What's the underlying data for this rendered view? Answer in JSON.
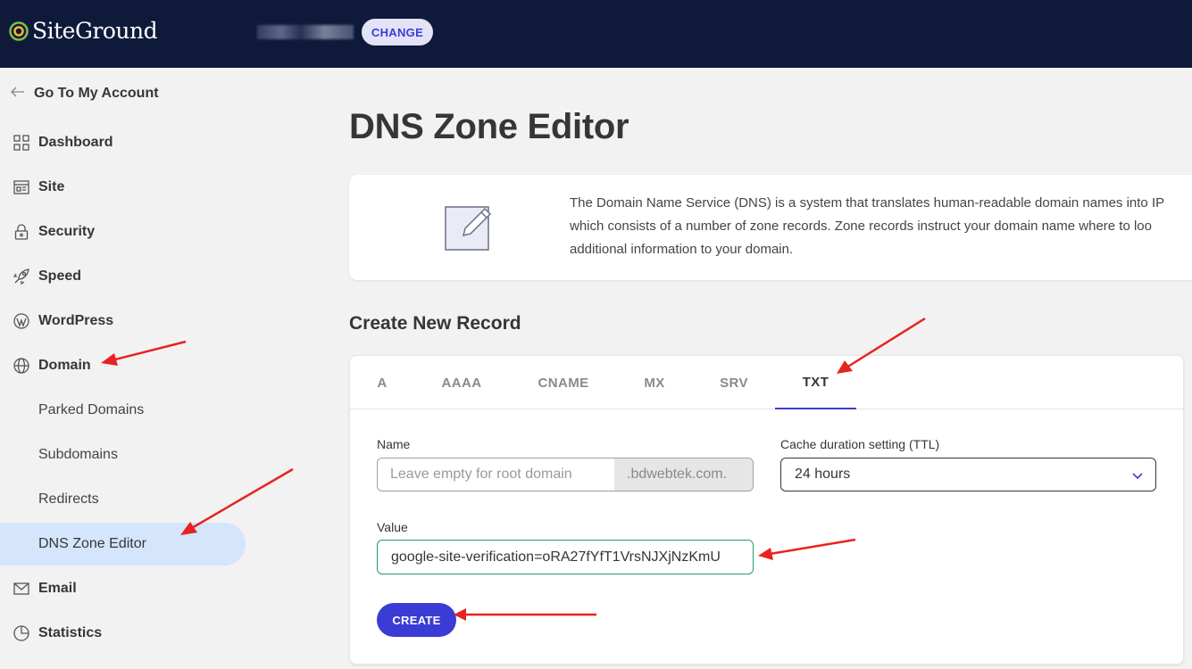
{
  "header": {
    "logo_text": "SiteGround",
    "change_label": "CHANGE"
  },
  "sidebar": {
    "back_label": "Go To My Account",
    "items": [
      {
        "label": "Dashboard",
        "icon": "dashboard-icon"
      },
      {
        "label": "Site",
        "icon": "site-icon"
      },
      {
        "label": "Security",
        "icon": "lock-icon"
      },
      {
        "label": "Speed",
        "icon": "rocket-icon"
      },
      {
        "label": "WordPress",
        "icon": "wordpress-icon"
      },
      {
        "label": "Domain",
        "icon": "globe-icon"
      }
    ],
    "domain_subitems": [
      {
        "label": "Parked Domains"
      },
      {
        "label": "Subdomains"
      },
      {
        "label": "Redirects"
      },
      {
        "label": "DNS Zone Editor",
        "active": true
      }
    ],
    "bottom_items": [
      {
        "label": "Email",
        "icon": "mail-icon"
      },
      {
        "label": "Statistics",
        "icon": "pie-chart-icon"
      }
    ]
  },
  "main": {
    "title": "DNS Zone Editor",
    "info_lines": [
      "The Domain Name Service (DNS) is a system that translates human-readable domain names into IP",
      "which consists of a number of zone records. Zone records instruct your domain name where to loo",
      "additional information to your domain."
    ],
    "section_title": "Create New Record",
    "tabs": [
      "A",
      "AAAA",
      "CNAME",
      "MX",
      "SRV",
      "TXT"
    ],
    "active_tab": "TXT",
    "form": {
      "name_label": "Name",
      "name_placeholder": "Leave empty for root domain",
      "name_suffix": ".bdwebtek.com.",
      "ttl_label": "Cache duration setting (TTL)",
      "ttl_value": "24 hours",
      "value_label": "Value",
      "value_text": "google-site-verification=oRA27fYfT1VrsNJXjNzKmU",
      "create_label": "CREATE"
    }
  },
  "colors": {
    "header_bg": "#0f1a3b",
    "accent": "#3b3bd5",
    "active_nav_bg": "#d5e5fb",
    "annotation_arrow": "#e8231f",
    "value_border": "#1f9e6e"
  }
}
